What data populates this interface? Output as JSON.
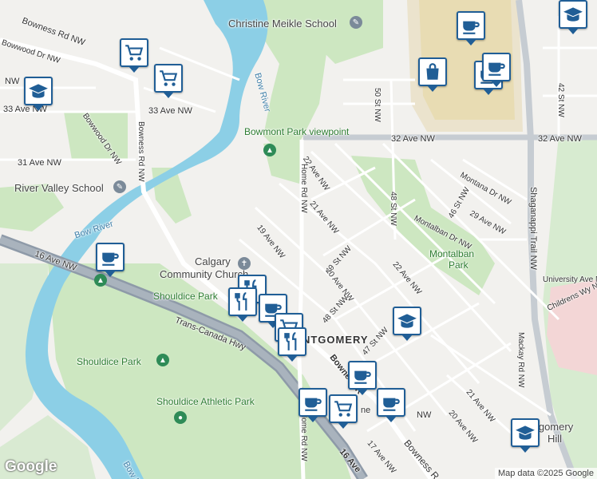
{
  "colors": {
    "water": "#8ccfe6",
    "park": "#cde7c1",
    "highway": "#8e9aa8",
    "major_road": "#ffffff",
    "pin_border": "#205e96"
  },
  "labels": {
    "bowness_rd_nw_top": "Bowness Rd NW",
    "bowwood_dr_nw_top": "Bowwood Dr NW",
    "nw_fragment": "NW",
    "ave33_left": "33 Ave NW",
    "ave33_mid": "33 Ave NW",
    "bowwood_dr_nw": "Bowwood Dr NW",
    "bowness_rd_nw_vertical": "Bowness Rd NW",
    "ave31": "31 Ave NW",
    "christine_meikle": "Christine Meikle School",
    "bow_river_top": "Bow River",
    "bowmont_viewpoint": "Bowmont Park viewpoint",
    "river_valley_school": "River Valley School",
    "bow_river_left": "Bow River",
    "ave16_left": "16 Ave NW",
    "calgary_church_1": "Calgary",
    "calgary_church_2": "Community Church",
    "shouldice_park_top": "Shouldice Park",
    "trans_canada": "Trans-Canada Hwy",
    "montgomery": "MONTGOMERY",
    "shouldice_park": "Shouldice Park",
    "shouldice_athletic": "Shouldice Athletic Park",
    "bow_river_bottom": "Bow River",
    "st50": "50 St NW",
    "ave32": "32 Ave NW",
    "ave32_right": "32 Ave NW",
    "st42": "42 St NW",
    "st22_ave": "22 Ave NW",
    "home_rd": "Home Rd NW",
    "home_rd_bottom": "Home Rd NW",
    "ave21": "21 Ave NW",
    "st48": "48 St NW",
    "montana_dr": "Montana Dr NW",
    "st46": "46 St NW",
    "ave29": "29 Ave NW",
    "montalban_dr": "Montalban Dr NW",
    "shaganappi": "Shaganappi Trail NW",
    "ave19": "19 Ave NW",
    "st49": "49 St NW",
    "ave20": "20 Ave NW",
    "montalban_park_1": "Montalban",
    "montalban_park_2": "Park",
    "ave22": "22 Ave NW",
    "university_ave": "University Ave NW",
    "childrens_way": "Childrens Wy NW",
    "st48b": "48 St NW",
    "st47": "47 St NW",
    "bowness_rd_bottom": "Bowness R",
    "mackay_rd": "Mackay Rd NW",
    "ave21_bottom": "21 Ave NW",
    "ave20_bottom": "20 Ave NW",
    "ave17": "17 Ave NW",
    "ave16_bottom": "16 Ave",
    "montgomery_hill_1": "ntgomery",
    "montgomery_hill_2": "Hill",
    "tail_ne": "ne",
    "tail_nw": "NW"
  },
  "pins": [
    {
      "id": "shopping-cart",
      "icon": "cart"
    },
    {
      "id": "shopping-cart",
      "icon": "cart"
    },
    {
      "id": "school",
      "icon": "school"
    },
    {
      "id": "coffee",
      "icon": "cup"
    },
    {
      "id": "shopping-bag",
      "icon": "bag"
    },
    {
      "id": "coffee",
      "icon": "cup"
    },
    {
      "id": "coffee",
      "icon": "cup"
    },
    {
      "id": "coffee",
      "icon": "cup"
    },
    {
      "id": "restaurant",
      "icon": "fork"
    },
    {
      "id": "restaurant",
      "icon": "fork"
    },
    {
      "id": "coffee",
      "icon": "cup"
    },
    {
      "id": "shopping-cart",
      "icon": "cart"
    },
    {
      "id": "restaurant",
      "icon": "fork"
    },
    {
      "id": "school",
      "icon": "school"
    },
    {
      "id": "coffee",
      "icon": "cup"
    },
    {
      "id": "coffee",
      "icon": "cup"
    },
    {
      "id": "shopping-cart",
      "icon": "cart"
    },
    {
      "id": "coffee",
      "icon": "cup"
    },
    {
      "id": "school",
      "icon": "school"
    },
    {
      "id": "school",
      "icon": "school"
    }
  ],
  "attribution": {
    "logo": "Google",
    "text": "Map data ©2025 Google"
  }
}
